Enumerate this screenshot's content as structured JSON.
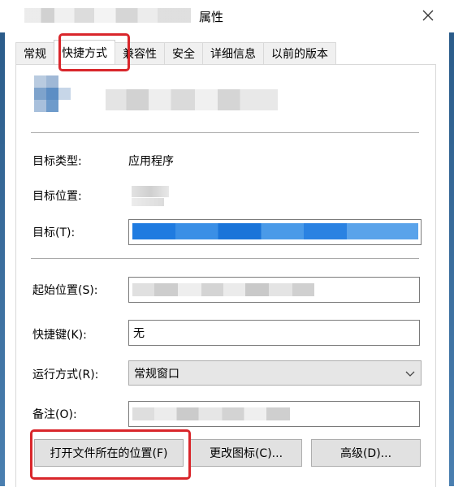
{
  "window": {
    "title": "属性",
    "close_icon": "close-icon"
  },
  "tabs": [
    {
      "label": "常规"
    },
    {
      "label": "快捷方式",
      "active": true
    },
    {
      "label": "兼容性"
    },
    {
      "label": "安全"
    },
    {
      "label": "详细信息"
    },
    {
      "label": "以前的版本"
    }
  ],
  "fields": {
    "target_type_label": "目标类型:",
    "target_type_value": "应用程序",
    "target_location_label": "目标位置:",
    "target_label": "目标(T):",
    "start_in_label": "起始位置(S):",
    "shortcut_key_label": "快捷键(K):",
    "shortcut_key_value": "无",
    "run_label": "运行方式(R):",
    "run_value": "常规窗口",
    "comment_label": "备注(O):"
  },
  "buttons": {
    "open_location": "打开文件所在的位置(F)",
    "change_icon": "更改图标(C)...",
    "advanced": "高级(D)..."
  },
  "colors": {
    "highlight_box": "#d9262b",
    "window_border": "#2b5c8a"
  }
}
